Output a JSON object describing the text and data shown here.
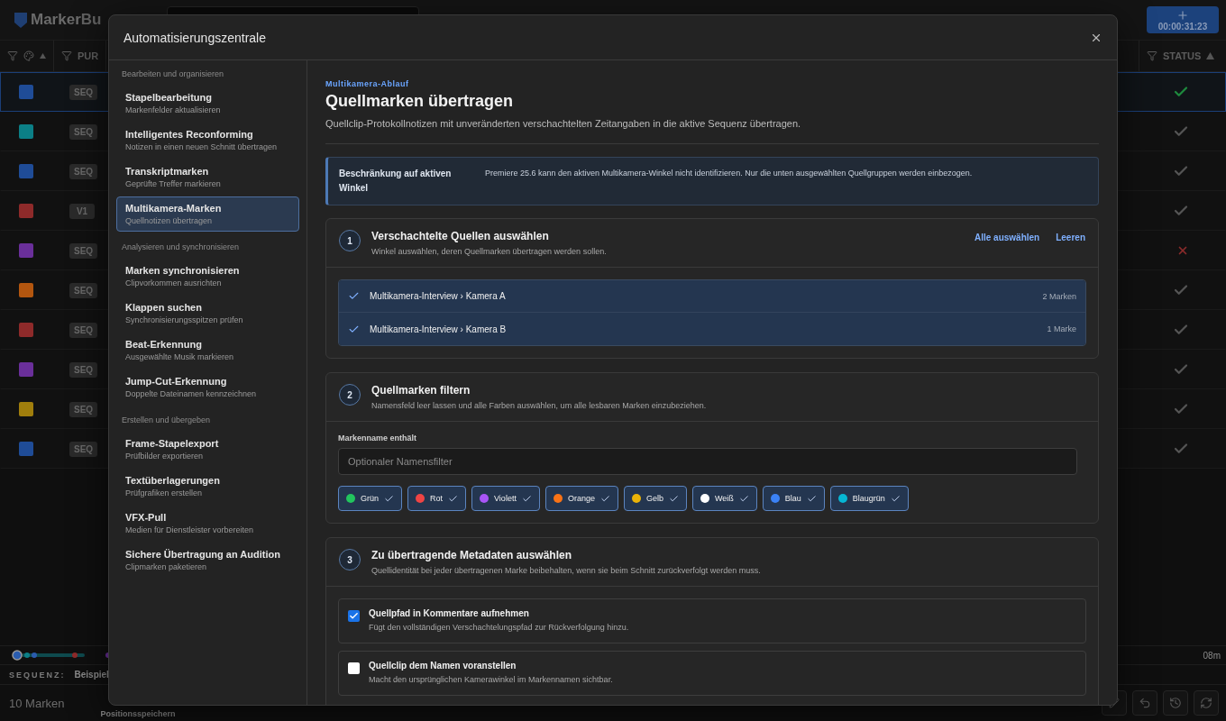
{
  "app": {
    "logo": {
      "strong": "Marker",
      "faded": "Bu"
    },
    "timecode": "00:00:31:23"
  },
  "table": {
    "column_2": "PUR",
    "status_column": "STATUS",
    "rows": [
      {
        "color": "#1f4c97",
        "track": "SEQ",
        "failed": false,
        "selected": true
      },
      {
        "color": "#0b7f86",
        "track": "SEQ",
        "failed": false,
        "selected": false
      },
      {
        "color": "#1f4c97",
        "track": "SEQ",
        "failed": false,
        "selected": false
      },
      {
        "color": "#8e2a2a",
        "track": "V1",
        "failed": false,
        "selected": false
      },
      {
        "color": "#6a2f9a",
        "track": "SEQ",
        "failed": true,
        "selected": false
      },
      {
        "color": "#b3560f",
        "track": "SEQ",
        "failed": false,
        "selected": false
      },
      {
        "color": "#8e2a2a",
        "track": "SEQ",
        "failed": false,
        "selected": false
      },
      {
        "color": "#6a2f9a",
        "track": "SEQ",
        "failed": false,
        "selected": false
      },
      {
        "color": "#a07e0c",
        "track": "SEQ",
        "failed": false,
        "selected": false
      },
      {
        "color": "#1f4c97",
        "track": "SEQ",
        "failed": false,
        "selected": false
      }
    ]
  },
  "timeline": {
    "end_label": "08m"
  },
  "sequence": {
    "label": "SEQUENZ:",
    "value": "Beispiel"
  },
  "footer": {
    "count": "10 Marken",
    "action": "Positionsspeichern"
  },
  "modal": {
    "title": "Automatisierungszentrale",
    "sidebar": [
      {
        "heading": "Bearbeiten und organisieren",
        "items": [
          {
            "title": "Stapelbearbeitung",
            "subtitle": "Markenfelder aktualisieren",
            "selected": false
          },
          {
            "title": "Intelligentes Reconforming",
            "subtitle": "Notizen in einen neuen Schnitt übertragen",
            "selected": false
          },
          {
            "title": "Transkriptmarken",
            "subtitle": "Geprüfte Treffer markieren",
            "selected": false
          },
          {
            "title": "Multikamera-Marken",
            "subtitle": "Quellnotizen übertragen",
            "selected": true
          }
        ]
      },
      {
        "heading": "Analysieren und synchronisieren",
        "items": [
          {
            "title": "Marken synchronisieren",
            "subtitle": "Clipvorkommen ausrichten",
            "selected": false
          },
          {
            "title": "Klappen suchen",
            "subtitle": "Synchronisierungsspitzen prüfen",
            "selected": false
          },
          {
            "title": "Beat-Erkennung",
            "subtitle": "Ausgewählte Musik markieren",
            "selected": false
          },
          {
            "title": "Jump-Cut-Erkennung",
            "subtitle": "Doppelte Dateinamen kennzeichnen",
            "selected": false
          }
        ]
      },
      {
        "heading": "Erstellen und übergeben",
        "items": [
          {
            "title": "Frame-Stapelexport",
            "subtitle": "Prüfbilder exportieren",
            "selected": false
          },
          {
            "title": "Textüberlagerungen",
            "subtitle": "Prüfgrafiken erstellen",
            "selected": false
          },
          {
            "title": "VFX-Pull",
            "subtitle": "Medien für Dienstleister vorbereiten",
            "selected": false
          },
          {
            "title": "Sichere Übertragung an Audition",
            "subtitle": "Clipmarken paketieren",
            "selected": false
          }
        ]
      }
    ],
    "content": {
      "eyebrow": "Multikamera-Ablauf",
      "title": "Quellmarken übertragen",
      "description": "Quellclip-Protokollnotizen mit unveränderten verschachtelten Zeitangaben in die aktive Sequenz übertragen.",
      "notice": {
        "title": "Beschränkung auf aktiven Winkel",
        "text": "Premiere 25.6 kann den aktiven Multikamera-Winkel nicht identifizieren. Nur die unten ausgewählten Quellgruppen werden einbezogen."
      },
      "steps": [
        {
          "kind": "sources",
          "number": "1",
          "title": "Verschachtelte Quellen auswählen",
          "subtitle": "Winkel auswählen, deren Quellmarken übertragen werden sollen.",
          "actions": [
            "Alle auswählen",
            "Leeren"
          ],
          "sources": [
            {
              "name": "Multikamera-Interview › Kamera A",
              "count": "2 Marken",
              "checked": true
            },
            {
              "name": "Multikamera-Interview › Kamera B",
              "count": "1 Marke",
              "checked": true
            }
          ]
        },
        {
          "kind": "filter",
          "number": "2",
          "title": "Quellmarken filtern",
          "subtitle": "Namensfeld leer lassen und alle Farben auswählen, um alle lesbaren Marken einzubeziehen.",
          "field_label": "Markenname enthält",
          "placeholder": "Optionaler Namensfilter",
          "colors": [
            {
              "label": "Grün",
              "color": "#22c55e",
              "checked": true
            },
            {
              "label": "Rot",
              "color": "#ef4444",
              "checked": true
            },
            {
              "label": "Violett",
              "color": "#a855f7",
              "checked": true
            },
            {
              "label": "Orange",
              "color": "#f97316",
              "checked": true
            },
            {
              "label": "Gelb",
              "color": "#eab308",
              "checked": true
            },
            {
              "label": "Weiß",
              "color": "#ffffff",
              "checked": true
            },
            {
              "label": "Blau",
              "color": "#3b82f6",
              "checked": true
            },
            {
              "label": "Blaugrün",
              "color": "#06b6d4",
              "checked": true
            }
          ]
        },
        {
          "kind": "metadata",
          "number": "3",
          "title": "Zu übertragende Metadaten auswählen",
          "subtitle": "Quellidentität bei jeder übertragenen Marke beibehalten, wenn sie beim Schnitt zurückverfolgt werden muss.",
          "options": [
            {
              "title": "Quellpfad in Kommentare aufnehmen",
              "description": "Fügt den vollständigen Verschachtelungspfad zur Rückverfolgung hinzu.",
              "checked": true
            },
            {
              "title": "Quellclip dem Namen voranstellen",
              "description": "Macht den ursprünglichen Kamerawinkel im Markennamen sichtbar.",
              "checked": false
            }
          ]
        }
      ]
    }
  }
}
